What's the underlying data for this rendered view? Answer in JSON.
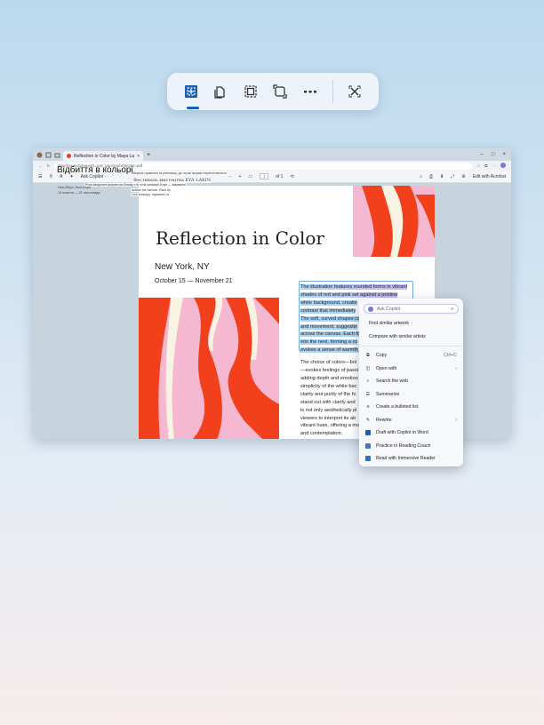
{
  "snip_toolbar": {
    "tools": [
      {
        "icon": "rectangle-snip-icon",
        "active": true
      },
      {
        "icon": "window-snip-icon",
        "active": false
      },
      {
        "icon": "fullscreen-snip-icon",
        "active": false
      },
      {
        "icon": "freeform-snip-icon",
        "active": false
      }
    ],
    "more_icon": "more-icon",
    "close_icon": "close-icon",
    "accent": "#1a5fb4"
  },
  "browser": {
    "tab_title": "Reflection in Color by Maya Larkin",
    "url": "file:///Users/Shared/Local_pacifics/reflection.pdf",
    "pdf_toolbar": {
      "ask_copilot": "Ask Copilot",
      "zoom_minus": "−",
      "zoom_plus": "+",
      "page_current": "1",
      "page_total": "of 1",
      "edit_label": "Edit with Acrobat"
    }
  },
  "translation_overlay": {
    "title": "Відбиття в кольорі",
    "sidebar_line1": "Нью-Йорк, Нью-Йорк",
    "sidebar_line2": "15 жовтня — 21 листопада",
    "snippet1": "зберігає гармонію та рівновагу, де гнучкі форми переплітаються",
    "snippet2": "Фестиваль мистецтва KYA LAKIN",
    "snippet3": "Різні закручені форми на білому тлі, чіткі кольори й рух — виражені",
    "snippet4": "across the canvas. Each flo",
    "snippet5": "того кольору, гармонія та"
  },
  "page": {
    "heading": "Reflection in Color",
    "city": "New York, NY",
    "dates": "October 15 — November 21",
    "selected_lines": [
      "The illustration features rounded forms in vibrant",
      "shades of red and pink set against a pristine",
      "white background, creatin",
      "contrast that immediately",
      "The soft, curved shapes co",
      "and movement, suggestin",
      "across the canvas. Each fo",
      "into the next, forming a co",
      "evokes a sense of warmth"
    ],
    "para2_lines": [
      "The choice of colors—bol",
      "—evokes feelings of passi",
      "adding depth and emotion",
      "simplicity of the white bac",
      "clarity and purity of the fo",
      "stand out with clarity and",
      "is not only aesthetically pl",
      "viewers to interpret its ab",
      "vibrant hues, offering a mo",
      "and contemplation."
    ],
    "art_colors": {
      "pink": "#f6b8d0",
      "red": "#f2401c",
      "cream": "#f8f3e3"
    }
  },
  "context_menu": {
    "ask_placeholder": "Ask Copilot",
    "items_group1": [
      "Find similar artwork",
      "Compare with similar artists"
    ],
    "copy": {
      "label": "Copy",
      "shortcut": "Ctrl+C"
    },
    "open_with": "Open with",
    "search_web": "Search the web",
    "summarize": "Summarize",
    "bulleted_list": "Create a bulleted list",
    "rewrite": "Rewrite",
    "draft_word": "Draft with Copilot in Word",
    "reading_coach": "Practice in Reading Coach",
    "immersive_reader": "Read with Immersive Reader"
  }
}
